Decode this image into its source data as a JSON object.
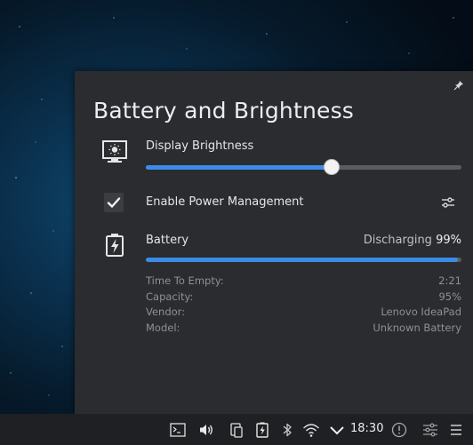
{
  "popup": {
    "title": "Battery and Brightness",
    "pin_icon": "pin-icon",
    "brightness": {
      "label": "Display Brightness",
      "icon": "display-brightness-icon",
      "level_percent": 59
    },
    "power_management": {
      "label": "Enable Power Management",
      "checked": true,
      "config_icon": "configure-icon"
    },
    "battery": {
      "label": "Battery",
      "icon": "battery-charging-icon",
      "status": "Discharging",
      "percent": "99%",
      "level_percent": 99,
      "details": [
        {
          "key": "Time To Empty:",
          "value": "2:21"
        },
        {
          "key": "Capacity:",
          "value": "95%"
        },
        {
          "key": "Vendor:",
          "value": "Lenovo IdeaPad"
        },
        {
          "key": "Model:",
          "value": "Unknown Battery"
        }
      ]
    }
  },
  "taskbar": {
    "clock": "18:30",
    "icons": [
      "terminal-icon",
      "volume-icon",
      "clipboard-icon",
      "battery-icon",
      "bluetooth-icon",
      "wifi-icon",
      "expand-tray-icon",
      "notifications-icon",
      "settings-sliders-icon",
      "menu-icon"
    ]
  },
  "colors": {
    "accent": "#3d8be8",
    "popup_bg": "#2a2c2f",
    "taskbar_bg": "#1f2023"
  }
}
